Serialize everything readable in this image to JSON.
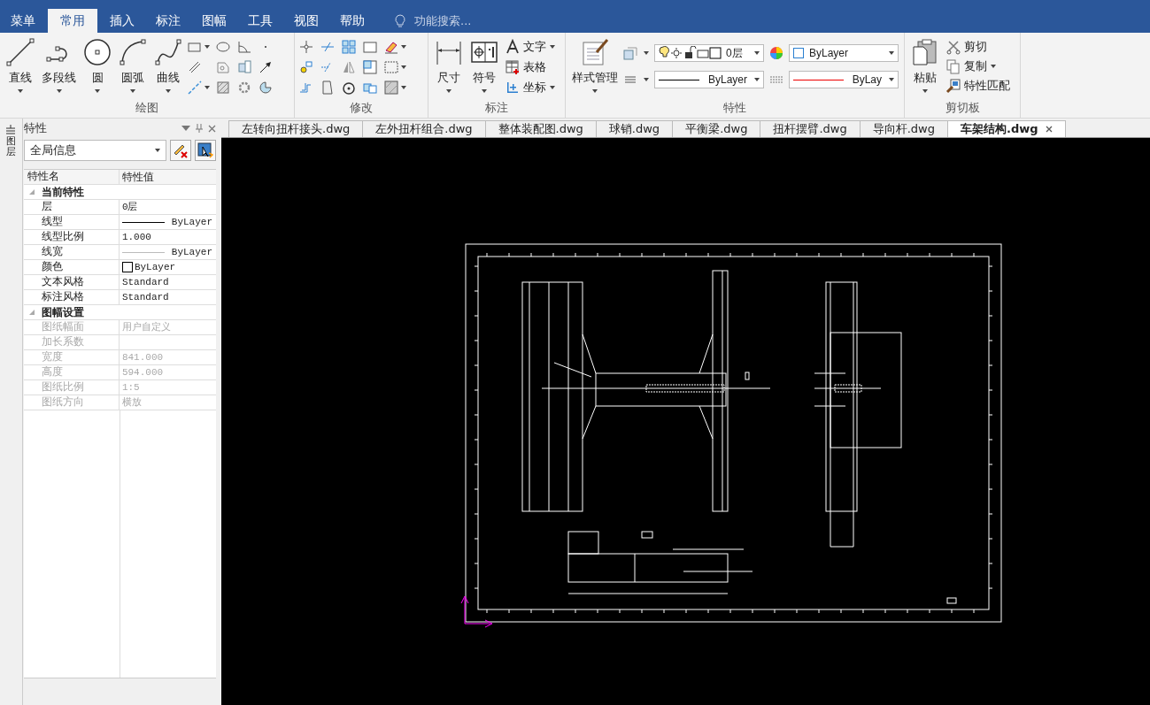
{
  "menu_tabs": [
    {
      "label": "菜单",
      "selected": false
    },
    {
      "label": "常用",
      "selected": true
    },
    {
      "label": "插入",
      "selected": false
    },
    {
      "label": "标注",
      "selected": false
    },
    {
      "label": "图幅",
      "selected": false
    },
    {
      "label": "工具",
      "selected": false
    },
    {
      "label": "视图",
      "selected": false
    },
    {
      "label": "帮助",
      "selected": false
    }
  ],
  "search": {
    "placeholder": "功能搜索..."
  },
  "ribbon": {
    "draw": {
      "title": "绘图",
      "tools": [
        {
          "label": "直线",
          "kind": "line"
        },
        {
          "label": "多段线",
          "kind": "polyline"
        },
        {
          "label": "圆",
          "kind": "circle"
        },
        {
          "label": "圆弧",
          "kind": "arc"
        },
        {
          "label": "曲线",
          "kind": "spline"
        }
      ]
    },
    "modify": {
      "title": "修改"
    },
    "annotate": {
      "title": "标注",
      "tools": [
        {
          "label": "尺寸",
          "kind": "dimension"
        },
        {
          "label": "符号",
          "kind": "symbol"
        }
      ],
      "small": [
        {
          "label": "文字",
          "kind": "text",
          "dropdown": true
        },
        {
          "label": "表格",
          "kind": "table",
          "dropdown": false
        },
        {
          "label": "坐标",
          "kind": "coordinate",
          "dropdown": true
        }
      ]
    },
    "properties": {
      "title": "特性",
      "tool": {
        "label": "样式管理"
      },
      "layer": "0层",
      "color_setting": "ByLayer",
      "linetype": "ByLayer",
      "lineweight": "ByLay"
    },
    "clipboard": {
      "title": "剪切板",
      "paste": {
        "label": "粘贴"
      },
      "items": [
        {
          "label": "剪切",
          "kind": "cut",
          "dropdown": false
        },
        {
          "label": "复制",
          "kind": "copy",
          "dropdown": true
        },
        {
          "label": "特性匹配",
          "kind": "match",
          "dropdown": false
        }
      ]
    }
  },
  "side_strip": {
    "label": "图层"
  },
  "properties_panel": {
    "title": "特性",
    "selector": "全局信息",
    "columns": [
      "特性名",
      "特性值"
    ],
    "sections": [
      {
        "title": "当前特性",
        "expanded": true,
        "rows": [
          {
            "name": "层",
            "value": "0层",
            "kind": "text",
            "disabled": false
          },
          {
            "name": "线型",
            "value": "ByLayer",
            "kind": "line",
            "disabled": false
          },
          {
            "name": "线型比例",
            "value": "1.000",
            "kind": "text",
            "disabled": false
          },
          {
            "name": "线宽",
            "value": "ByLayer",
            "kind": "thin_line",
            "disabled": false
          },
          {
            "name": "颜色",
            "value": "ByLayer",
            "kind": "swatch",
            "disabled": false
          },
          {
            "name": "文本风格",
            "value": "Standard",
            "kind": "text",
            "disabled": false
          },
          {
            "name": "标注风格",
            "value": "Standard",
            "kind": "text",
            "disabled": false
          }
        ]
      },
      {
        "title": "图幅设置",
        "expanded": true,
        "rows": [
          {
            "name": "图纸幅面",
            "value": "用户自定义",
            "kind": "text",
            "disabled": true
          },
          {
            "name": "加长系数",
            "value": "",
            "kind": "text",
            "disabled": true
          },
          {
            "name": "宽度",
            "value": "841.000",
            "kind": "text",
            "disabled": true
          },
          {
            "name": "高度",
            "value": "594.000",
            "kind": "text",
            "disabled": true
          },
          {
            "name": "图纸比例",
            "value": "1:5",
            "kind": "text",
            "disabled": true
          },
          {
            "name": "图纸方向",
            "value": "横放",
            "kind": "text",
            "disabled": true
          }
        ]
      }
    ]
  },
  "file_tabs": [
    {
      "label": "左转向扭杆接头.dwg",
      "selected": false
    },
    {
      "label": "左外扭杆组合.dwg",
      "selected": false
    },
    {
      "label": "整体装配图.dwg",
      "selected": false
    },
    {
      "label": "球销.dwg",
      "selected": false
    },
    {
      "label": "平衡梁.dwg",
      "selected": false
    },
    {
      "label": "扭杆摆臂.dwg",
      "selected": false
    },
    {
      "label": "导向杆.dwg",
      "selected": false
    },
    {
      "label": "车架结构.dwg",
      "selected": true
    }
  ]
}
